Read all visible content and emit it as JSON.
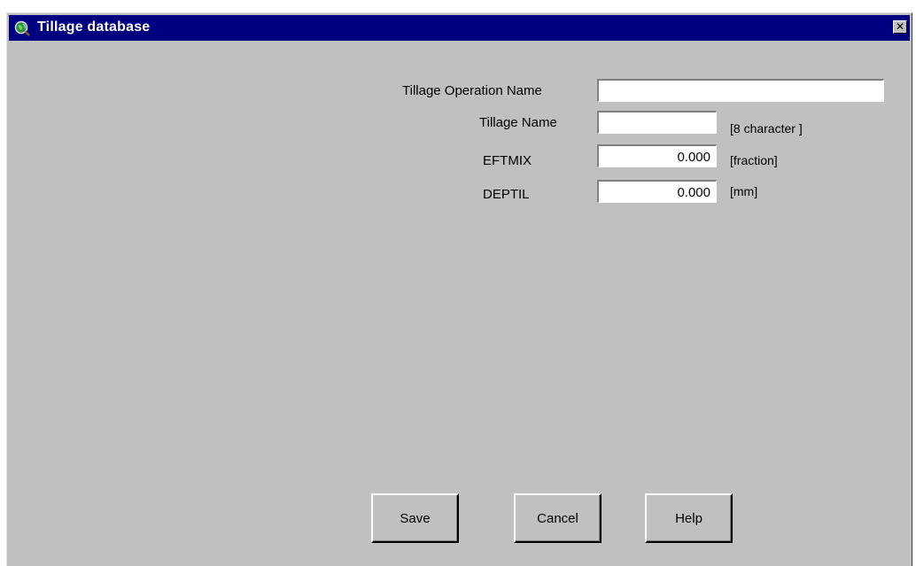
{
  "window": {
    "title": "Tillage database",
    "icon": "globe-magnifier-icon",
    "close_label": "✕"
  },
  "form": {
    "operation_name": {
      "label": "Tillage Operation Name",
      "value": ""
    },
    "tillage_name": {
      "label": "Tillage Name",
      "value": "",
      "unit": "[8 character ]"
    },
    "eftmix": {
      "label": "EFTMIX",
      "value": "0.000",
      "unit": "[fraction]"
    },
    "deptil": {
      "label": "DEPTIL",
      "value": "0.000",
      "unit": "[mm]"
    }
  },
  "buttons": {
    "save": "Save",
    "cancel": "Cancel",
    "help": "Help"
  },
  "colors": {
    "titlebar": "#000080",
    "window_bg": "#c0c0c0"
  }
}
